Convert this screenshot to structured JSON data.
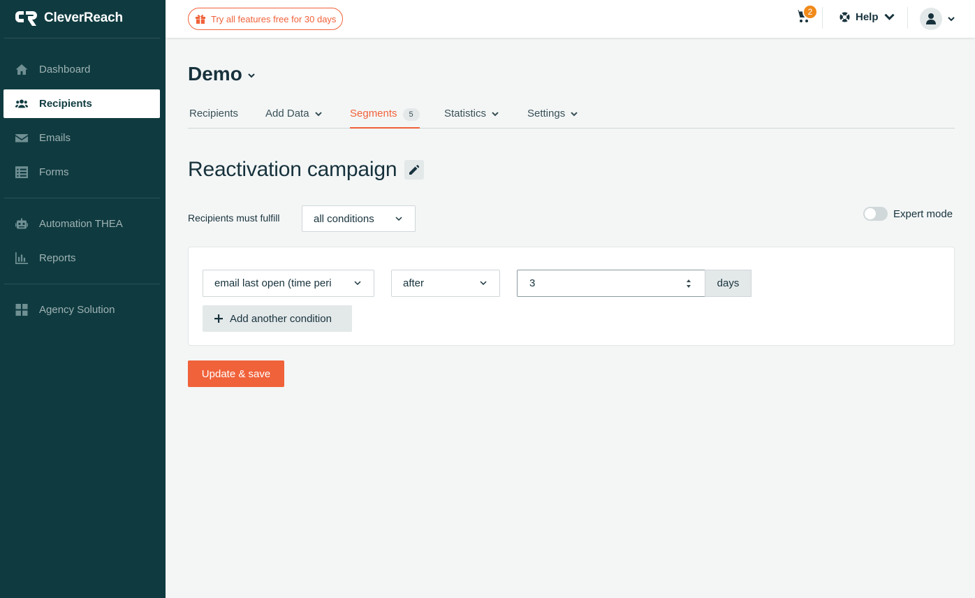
{
  "brand": {
    "name": "CleverReach",
    "accent": "#f0623a",
    "sidebar_bg": "#0f3b40"
  },
  "sidebar": {
    "items": [
      {
        "label": "Dashboard",
        "icon": "home-icon",
        "active": false
      },
      {
        "label": "Recipients",
        "icon": "users-icon",
        "active": true
      },
      {
        "label": "Emails",
        "icon": "envelope-icon",
        "active": false
      },
      {
        "label": "Forms",
        "icon": "form-icon",
        "active": false
      },
      {
        "label": "Automation THEA",
        "icon": "robot-icon",
        "active": false
      },
      {
        "label": "Reports",
        "icon": "bar-chart-icon",
        "active": false
      },
      {
        "label": "Agency Solution",
        "icon": "grid-icon",
        "active": false
      }
    ]
  },
  "topbar": {
    "trial_label": "Try all features free for 30 days",
    "cart_count": "2",
    "help_label": "Help"
  },
  "page": {
    "title": "Demo",
    "tabs": [
      {
        "label": "Recipients",
        "active": false,
        "dropdown": false
      },
      {
        "label": "Add Data",
        "active": false,
        "dropdown": true
      },
      {
        "label": "Segments",
        "active": true,
        "badge": "5"
      },
      {
        "label": "Statistics",
        "active": false,
        "dropdown": true
      },
      {
        "label": "Settings",
        "active": false,
        "dropdown": true
      }
    ]
  },
  "segment": {
    "title": "Reactivation campaign",
    "fulfill_label": "Recipients must fulfill",
    "fulfill_value": "all conditions",
    "expert_mode_label": "Expert mode",
    "expert_mode_on": false,
    "condition": {
      "field": "email last open (time peri",
      "operator": "after",
      "value": "3",
      "unit": "days"
    },
    "add_condition_label": "Add another condition",
    "save_label": "Update & save"
  }
}
